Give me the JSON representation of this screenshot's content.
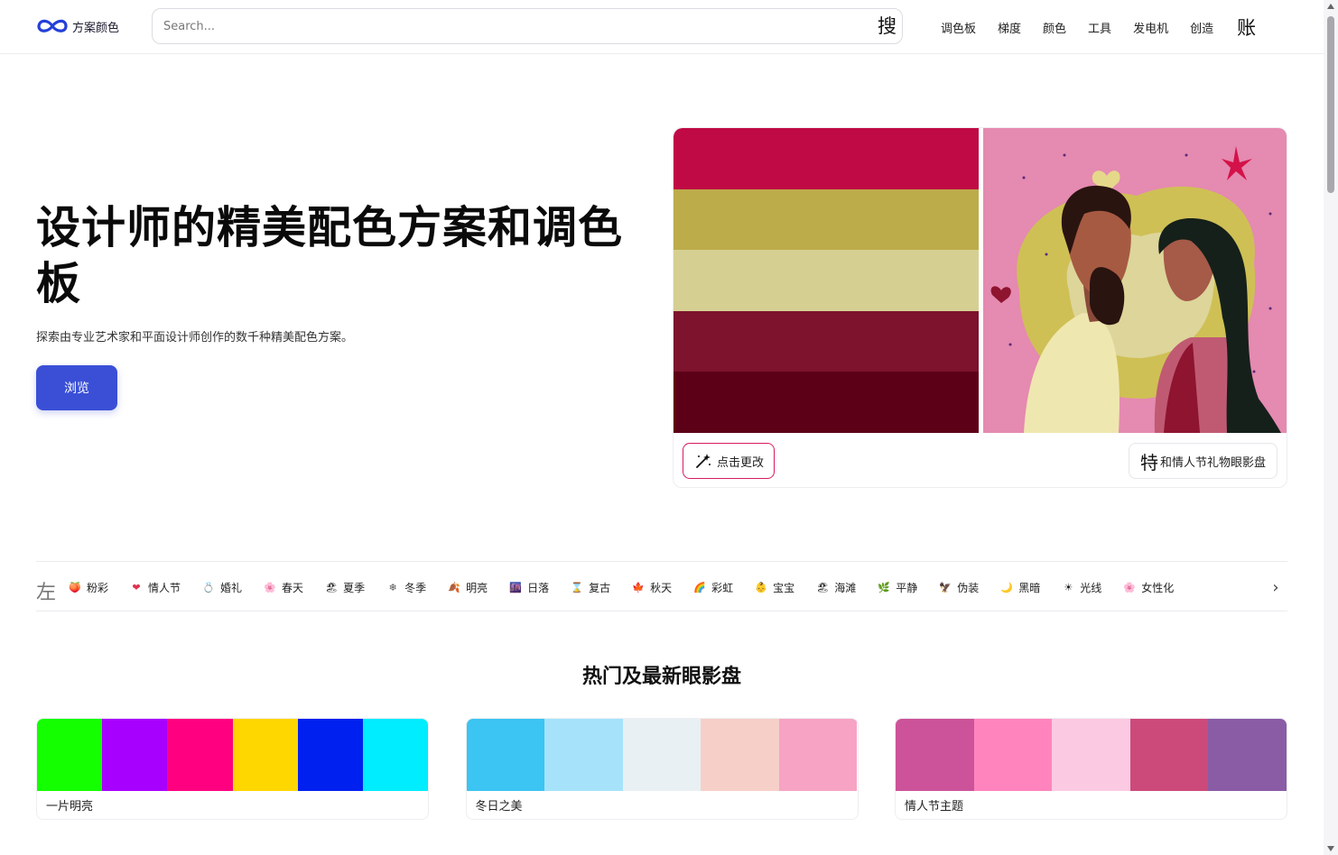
{
  "header": {
    "logo_text": "方案颜色",
    "search_placeholder": "Search...",
    "search_button": "搜",
    "nav": [
      "调色板",
      "梯度",
      "颜色",
      "工具",
      "发电机",
      "创造"
    ],
    "account": "账"
  },
  "hero": {
    "title": "设计师的精美配色方案和调色板",
    "subtitle": "探索由专业艺术家和平面设计师创作的数千种精美配色方案。",
    "browse": "浏览",
    "palette": [
      "#c00a45",
      "#bcac4a",
      "#d5cf92",
      "#7d132d",
      "#5c0018"
    ],
    "change_button": "点击更改",
    "feature_prefix": "特",
    "feature_label": "和情人节礼物眼影盘"
  },
  "categories": {
    "left_label": "左",
    "items": [
      {
        "icon": "🍑",
        "label": "粉彩",
        "color": "#e89aa0"
      },
      {
        "icon": "❤",
        "label": "情人节",
        "color": "#e0314f"
      },
      {
        "icon": "💍",
        "label": "婚礼",
        "color": "#8aa0c8"
      },
      {
        "icon": "🌸",
        "label": "春天",
        "color": "#f07aa0"
      },
      {
        "icon": "🏖",
        "label": "夏季",
        "color": "#333333"
      },
      {
        "icon": "❄",
        "label": "冬季",
        "color": "#555555"
      },
      {
        "icon": "🍂",
        "label": "明亮",
        "color": "#e06a2a"
      },
      {
        "icon": "🌆",
        "label": "日落",
        "color": "#6a4ab8"
      },
      {
        "icon": "⌛",
        "label": "复古",
        "color": "#b8a06a"
      },
      {
        "icon": "🍁",
        "label": "秋天",
        "color": "#d13a2a"
      },
      {
        "icon": "🌈",
        "label": "彩虹",
        "color": "#e0902a"
      },
      {
        "icon": "👶",
        "label": "宝宝",
        "color": "#e0b02a"
      },
      {
        "icon": "🏖",
        "label": "海滩",
        "color": "#333333"
      },
      {
        "icon": "🌿",
        "label": "平静",
        "color": "#5aa04a"
      },
      {
        "icon": "🦅",
        "label": "伪装",
        "color": "#777777"
      },
      {
        "icon": "🌙",
        "label": "黑暗",
        "color": "#d0b030"
      },
      {
        "icon": "☀",
        "label": "光线",
        "color": "#222222"
      },
      {
        "icon": "🌸",
        "label": "女性化",
        "color": "#f07aa0"
      }
    ],
    "right_arrow": "›"
  },
  "section": {
    "title": "热门及最新眼影盘",
    "cards": [
      {
        "name": "一片明亮",
        "colors": [
          "#14ff00",
          "#a800ff",
          "#ff0080",
          "#ffd700",
          "#0020f0",
          "#00ecff"
        ]
      },
      {
        "name": "冬日之美",
        "colors": [
          "#3cc4f2",
          "#a6e3fb",
          "#e8f0f4",
          "#f6d0c8",
          "#f7a4c4"
        ]
      },
      {
        "name": "情人节主题",
        "colors": [
          "#cc5399",
          "#ff84bd",
          "#fbcae2",
          "#cc4a7a",
          "#8a5ca6"
        ]
      }
    ]
  }
}
